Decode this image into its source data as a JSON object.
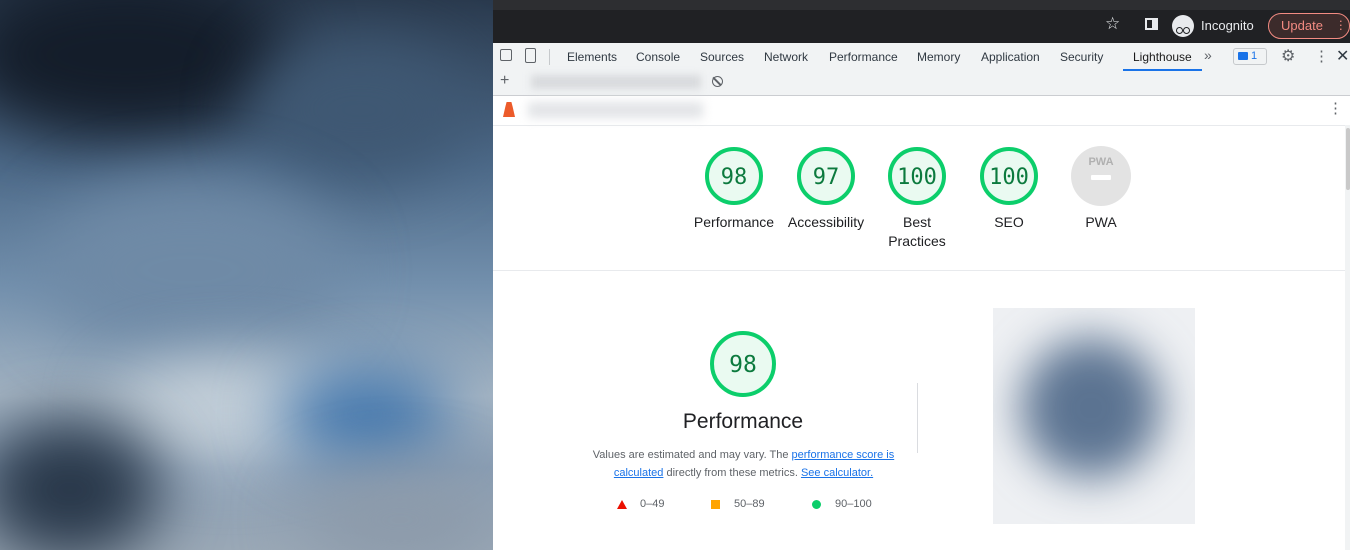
{
  "browser": {
    "incognito_label": "Incognito",
    "update_label": "Update"
  },
  "devtools": {
    "tabs": [
      "Elements",
      "Console",
      "Sources",
      "Network",
      "Performance",
      "Memory",
      "Application",
      "Security",
      "Lighthouse"
    ],
    "active_tab": "Lighthouse",
    "issues_count": "1"
  },
  "scores": [
    {
      "value": "98",
      "label": "Performance",
      "color": "#0cce6b"
    },
    {
      "value": "97",
      "label": "Accessibility",
      "color": "#0cce6b"
    },
    {
      "value": "100",
      "label": "Best Practices",
      "color": "#0cce6b"
    },
    {
      "value": "100",
      "label": "SEO",
      "color": "#0cce6b"
    },
    {
      "value": "PWA",
      "label": "PWA",
      "color": "#cccccc"
    }
  ],
  "performance": {
    "score": "98",
    "title": "Performance",
    "desc_prefix": "Values are estimated and may vary. The ",
    "desc_link1": "performance score is calculated",
    "desc_middle": " directly from these metrics. ",
    "desc_link2": "See calculator."
  },
  "legend": {
    "fail": "0–49",
    "average": "50–89",
    "pass": "90–100"
  }
}
